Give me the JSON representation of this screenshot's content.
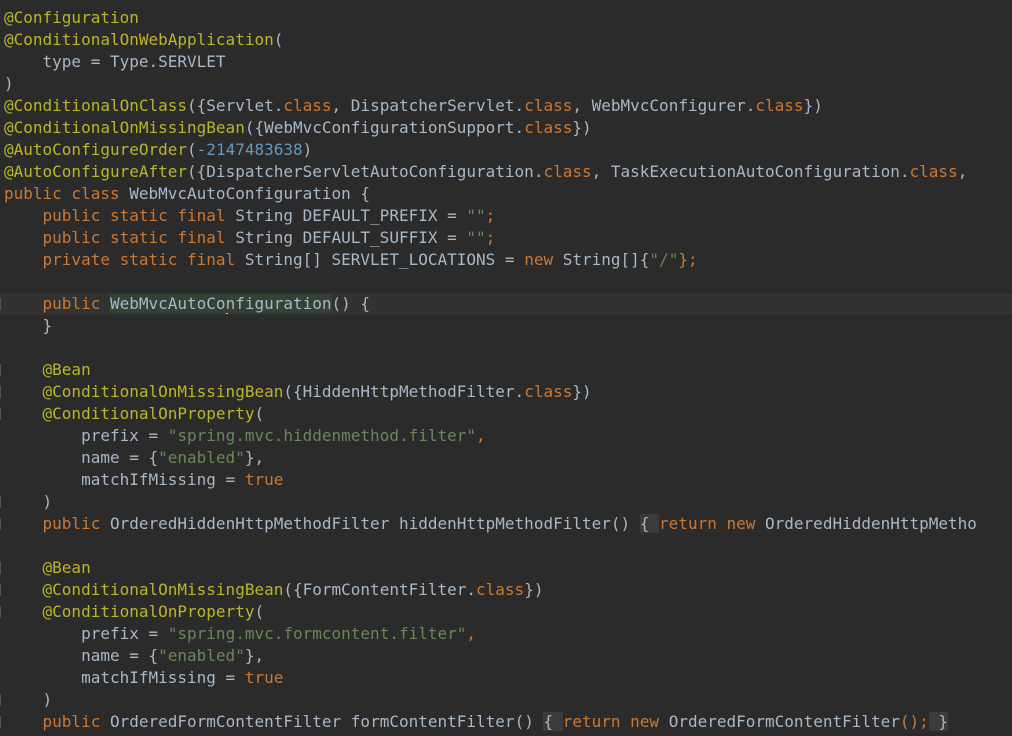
{
  "editor": {
    "lines": [
      [
        {
          "t": "@Configuration",
          "c": "ann"
        }
      ],
      [
        {
          "t": "@ConditionalOnWebApplication",
          "c": "ann"
        },
        {
          "t": "(",
          "c": "id"
        }
      ],
      [
        {
          "t": "    type = Type.",
          "c": "id"
        },
        {
          "t": "SERVLET",
          "c": "id"
        }
      ],
      [
        {
          "t": ")",
          "c": "id"
        }
      ],
      [
        {
          "t": "@ConditionalOnClass",
          "c": "ann"
        },
        {
          "t": "({Servlet.",
          "c": "id"
        },
        {
          "t": "class",
          "c": "kw"
        },
        {
          "t": ", DispatcherServlet.",
          "c": "id"
        },
        {
          "t": "class",
          "c": "kw"
        },
        {
          "t": ", WebMvcConfigurer.",
          "c": "id"
        },
        {
          "t": "class",
          "c": "kw"
        },
        {
          "t": "})",
          "c": "id"
        }
      ],
      [
        {
          "t": "@ConditionalOnMissingBean",
          "c": "ann"
        },
        {
          "t": "({WebMvcConfigurationSupport.",
          "c": "id"
        },
        {
          "t": "class",
          "c": "kw"
        },
        {
          "t": "})",
          "c": "id"
        }
      ],
      [
        {
          "t": "@AutoConfigureOrder",
          "c": "ann"
        },
        {
          "t": "(",
          "c": "id"
        },
        {
          "t": "-2147483638",
          "c": "num"
        },
        {
          "t": ")",
          "c": "id"
        }
      ],
      [
        {
          "t": "@AutoConfigureAfter",
          "c": "ann"
        },
        {
          "t": "({DispatcherServletAutoConfiguration.",
          "c": "id"
        },
        {
          "t": "class",
          "c": "kw"
        },
        {
          "t": ", TaskExecutionAutoConfiguration.",
          "c": "id"
        },
        {
          "t": "class",
          "c": "kw"
        },
        {
          "t": ",",
          "c": "id"
        }
      ],
      [
        {
          "t": "public class ",
          "c": "kw"
        },
        {
          "t": "WebMvcAutoConfiguration {",
          "c": "id"
        }
      ],
      [
        {
          "t": "    public static final ",
          "c": "kw"
        },
        {
          "t": "String DEFAULT_PREFIX = ",
          "c": "id"
        },
        {
          "t": "\"\"",
          "c": "str"
        },
        {
          "t": ";",
          "c": "kw"
        }
      ],
      [
        {
          "t": "    public static final ",
          "c": "kw"
        },
        {
          "t": "String DEFAULT_SUFFIX = ",
          "c": "id"
        },
        {
          "t": "\"\"",
          "c": "str"
        },
        {
          "t": ";",
          "c": "kw"
        }
      ],
      [
        {
          "t": "    private static final ",
          "c": "kw"
        },
        {
          "t": "String[] SERVLET_LOCATIONS = ",
          "c": "id"
        },
        {
          "t": "new ",
          "c": "kw"
        },
        {
          "t": "String[]{",
          "c": "id"
        },
        {
          "t": "\"/\"",
          "c": "str"
        },
        {
          "t": "};",
          "c": "kw"
        }
      ],
      [],
      [
        {
          "t": "    public ",
          "c": "kw"
        },
        {
          "t": "WebMvcAutoCo",
          "c": "hl"
        },
        {
          "t": "",
          "c": "caret"
        },
        {
          "t": "nfiguration",
          "c": "hl"
        },
        {
          "t": "() {",
          "c": "id"
        }
      ],
      [
        {
          "t": "    }",
          "c": "id"
        }
      ],
      [],
      [
        {
          "t": "    @Bean",
          "c": "ann"
        }
      ],
      [
        {
          "t": "    @ConditionalOnMissingBean",
          "c": "ann"
        },
        {
          "t": "({HiddenHttpMethodFilter.",
          "c": "id"
        },
        {
          "t": "class",
          "c": "kw"
        },
        {
          "t": "})",
          "c": "id"
        }
      ],
      [
        {
          "t": "    @ConditionalOnProperty",
          "c": "ann"
        },
        {
          "t": "(",
          "c": "id"
        }
      ],
      [
        {
          "t": "        prefix = ",
          "c": "id"
        },
        {
          "t": "\"spring.mvc.hiddenmethod.filter\"",
          "c": "str"
        },
        {
          "t": ",",
          "c": "kw"
        }
      ],
      [
        {
          "t": "        name = {",
          "c": "id"
        },
        {
          "t": "\"enabled\"",
          "c": "str"
        },
        {
          "t": "},",
          "c": "id"
        }
      ],
      [
        {
          "t": "        matchIfMissing = ",
          "c": "id"
        },
        {
          "t": "true",
          "c": "kw"
        }
      ],
      [
        {
          "t": "    )",
          "c": "id"
        }
      ],
      [
        {
          "t": "    public ",
          "c": "kw"
        },
        {
          "t": "OrderedHiddenHttpMethodFilter ",
          "c": "id"
        },
        {
          "t": "hiddenHttpMethodFilter",
          "c": "id"
        },
        {
          "t": "() ",
          "c": "id"
        },
        {
          "t": "{ ",
          "c": "fold"
        },
        {
          "t": "return new ",
          "c": "kw"
        },
        {
          "t": "OrderedHiddenHttpMetho",
          "c": "id"
        }
      ],
      [],
      [
        {
          "t": "    @Bean",
          "c": "ann"
        }
      ],
      [
        {
          "t": "    @ConditionalOnMissingBean",
          "c": "ann"
        },
        {
          "t": "({FormContentFilter.",
          "c": "id"
        },
        {
          "t": "class",
          "c": "kw"
        },
        {
          "t": "})",
          "c": "id"
        }
      ],
      [
        {
          "t": "    @ConditionalOnProperty",
          "c": "ann"
        },
        {
          "t": "(",
          "c": "id"
        }
      ],
      [
        {
          "t": "        prefix = ",
          "c": "id"
        },
        {
          "t": "\"spring.mvc.formcontent.filter\"",
          "c": "str"
        },
        {
          "t": ",",
          "c": "kw"
        }
      ],
      [
        {
          "t": "        name = {",
          "c": "id"
        },
        {
          "t": "\"enabled\"",
          "c": "str"
        },
        {
          "t": "},",
          "c": "id"
        }
      ],
      [
        {
          "t": "        matchIfMissing = ",
          "c": "id"
        },
        {
          "t": "true",
          "c": "kw"
        }
      ],
      [
        {
          "t": "    )",
          "c": "id"
        }
      ],
      [
        {
          "t": "    public ",
          "c": "kw"
        },
        {
          "t": "OrderedFormContentFilter ",
          "c": "id"
        },
        {
          "t": "formContentFilter",
          "c": "id"
        },
        {
          "t": "() ",
          "c": "id"
        },
        {
          "t": "{ ",
          "c": "fold"
        },
        {
          "t": "return new ",
          "c": "kw"
        },
        {
          "t": "OrderedFormContentFilter",
          "c": "id"
        },
        {
          "t": "();",
          "c": "kw"
        },
        {
          "t": " }",
          "c": "fold"
        }
      ]
    ],
    "current_line": 13,
    "colors": {
      "background": "#2b2b2b",
      "annotation": "#bbb529",
      "keyword": "#cc7832",
      "string": "#6a8759",
      "number": "#6897bb",
      "identifier": "#a9b7c6"
    }
  }
}
